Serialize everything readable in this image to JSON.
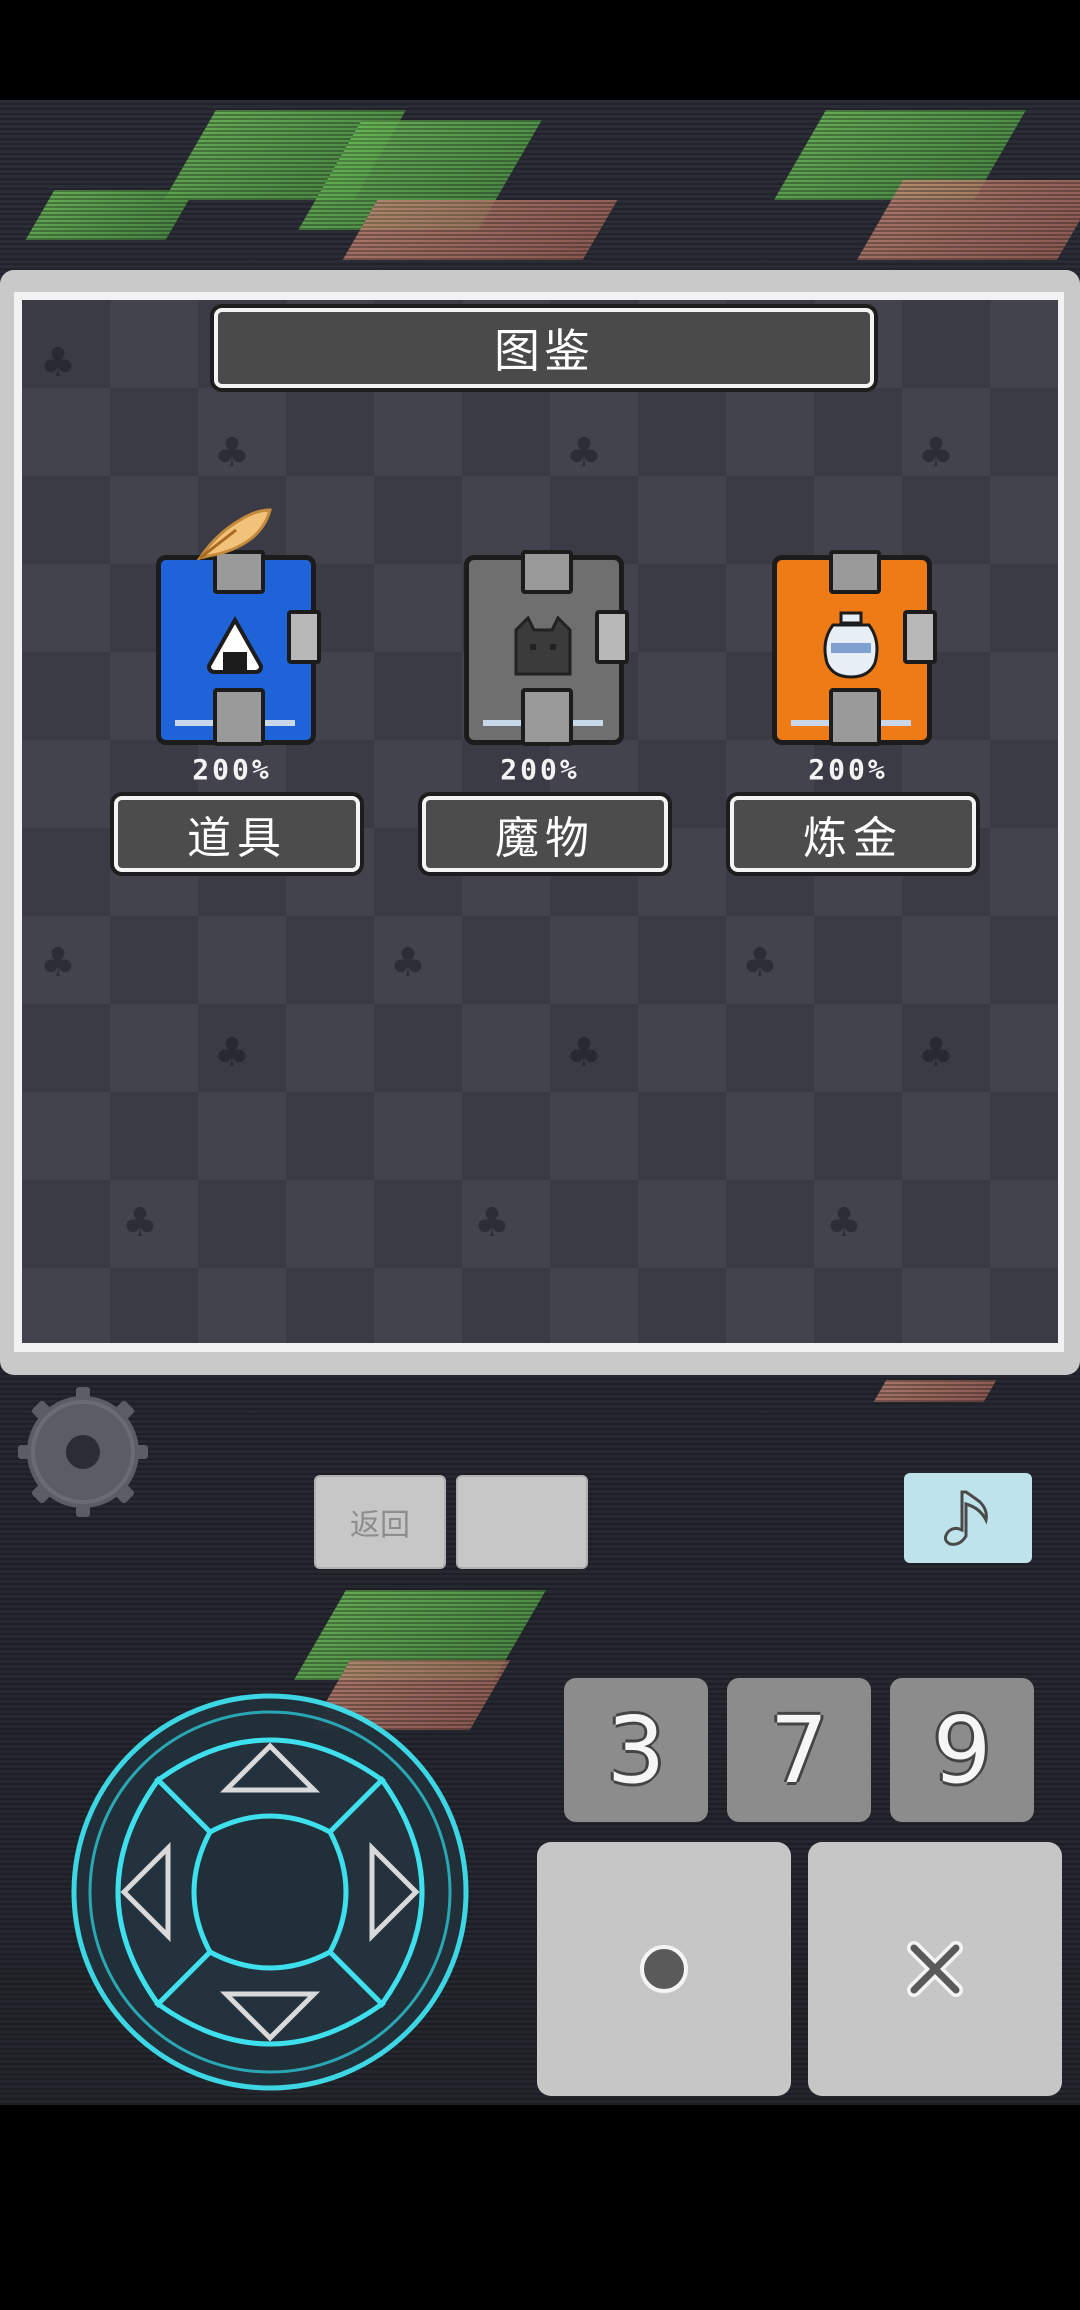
{
  "colors": {
    "accent_cyan": "#3fe0ee",
    "book_items": "#1f63d9",
    "book_monsters": "#6f6f6f",
    "book_alchemy": "#ef7b16",
    "panel_bg": "#3a3b45",
    "music_btn": "#bfe3ea"
  },
  "panel": {
    "title": "图鉴"
  },
  "categories": [
    {
      "label": "道具",
      "percent": "200%",
      "color": "#1f63d9",
      "emblem": "rice-ball-icon",
      "has_quill": true
    },
    {
      "label": "魔物",
      "percent": "200%",
      "color": "#6f6f6f",
      "emblem": "cat-silhouette-icon",
      "has_quill": false
    },
    {
      "label": "炼金",
      "percent": "200%",
      "color": "#ef7b16",
      "emblem": "vase-icon",
      "has_quill": false
    }
  ],
  "controls": {
    "back_label": "返回",
    "blank_label": "",
    "music_icon": "music-note-icon",
    "settings_icon": "gear-icon",
    "num_keys": [
      "3",
      "7",
      "9"
    ],
    "confirm_icon": "circle-icon",
    "cancel_icon": "cross-icon",
    "dpad_icons": [
      "arrow-up-icon",
      "arrow-left-icon",
      "arrow-right-icon",
      "arrow-down-icon"
    ]
  }
}
